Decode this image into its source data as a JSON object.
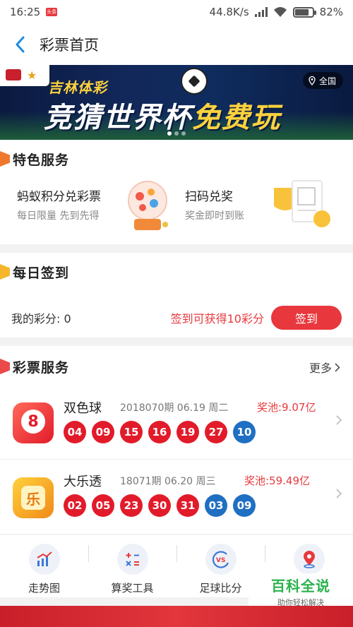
{
  "status": {
    "time": "16:25",
    "app_badge": "头条",
    "speed": "44.8K/s",
    "battery": "82%",
    "battery_level": 0.82
  },
  "nav": {
    "title": "彩票首页"
  },
  "banner": {
    "brand": "吉林体彩",
    "headline_main": "竞猜世界杯",
    "headline_accent": "免费玩",
    "region": "全国",
    "slide_index": 1,
    "slide_count": 3
  },
  "featured": {
    "title": "特色服务",
    "items": [
      {
        "name": "蚂蚁积分兑彩票",
        "desc": "每日限量 先到先得",
        "icon": "lottery-machine-icon"
      },
      {
        "name": "扫码兑奖",
        "desc": "奖金即时到账",
        "icon": "trophy-ticket-icon"
      }
    ]
  },
  "checkin": {
    "title": "每日签到",
    "points_label": "我的彩分: 0",
    "tip": "签到可获得10彩分",
    "button": "签到"
  },
  "lottery": {
    "title": "彩票服务",
    "more": "更多",
    "rows": [
      {
        "name": "双色球",
        "issue": "2018070期 06.19 周二",
        "pool": "奖池:9.07亿",
        "icon": "ball-8-icon",
        "red": [
          "04",
          "09",
          "15",
          "16",
          "19",
          "27"
        ],
        "blue": [
          "10"
        ]
      },
      {
        "name": "大乐透",
        "issue": "18071期 06.20 周三",
        "pool": "奖池:59.49亿",
        "icon": "le-badge-icon",
        "red": [
          "02",
          "05",
          "23",
          "30",
          "31"
        ],
        "blue": [
          "03",
          "09"
        ]
      }
    ]
  },
  "tools": [
    {
      "label": "走势图",
      "icon": "trend-chart-icon"
    },
    {
      "label": "算奖工具",
      "icon": "calculator-icon"
    },
    {
      "label": "足球比分",
      "icon": "vs-icon"
    },
    {
      "label": "",
      "icon": "location-pin-icon"
    }
  ],
  "watermark": {
    "main": "百科全说",
    "sub": "助你轻松解决"
  },
  "colors": {
    "accent": "#e8383d",
    "red_ball": "#e21b2a",
    "blue_ball": "#1f6fc2",
    "back_arrow": "#1a8ce6"
  }
}
